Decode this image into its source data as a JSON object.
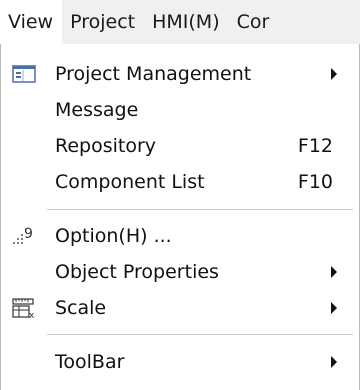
{
  "menubar": {
    "items": [
      "View",
      "Project",
      "HMI(M)",
      "Cor"
    ]
  },
  "menu": {
    "items": [
      {
        "label": "Project Management",
        "icon": "project-management-icon",
        "submenu": true
      },
      {
        "label": "Message"
      },
      {
        "label": "Repository",
        "shortcut": "F12"
      },
      {
        "label": "Component List",
        "shortcut": "F10"
      },
      {
        "label": "Option(H) ...",
        "icon": "option-icon"
      },
      {
        "label": "Object Properties",
        "submenu": true
      },
      {
        "label": "Scale",
        "icon": "scale-icon",
        "submenu": true
      },
      {
        "label": "ToolBar",
        "submenu": true
      }
    ]
  },
  "colors": {
    "menubar_bg": "#f0f0f0",
    "menu_bg": "#ffffff",
    "separator": "#c8c8c8",
    "text": "#111111"
  }
}
